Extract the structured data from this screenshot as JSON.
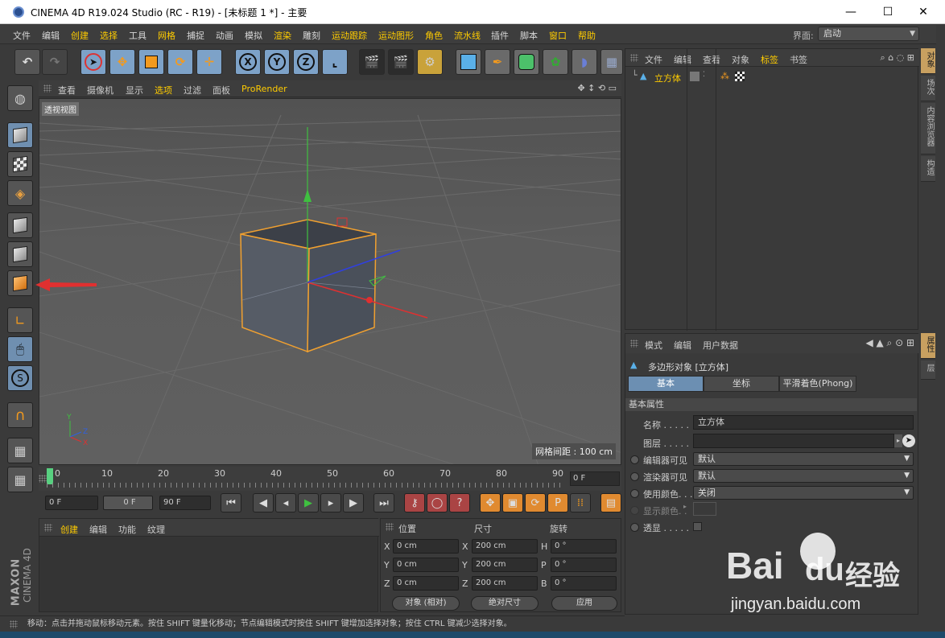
{
  "window": {
    "title": "CINEMA 4D R19.024 Studio (RC - R19) - [未标题 1 *] - 主要",
    "minimize": "—",
    "maximize": "☐",
    "close": "✕"
  },
  "menu": [
    "文件",
    "编辑",
    "创建",
    "选择",
    "工具",
    "网格",
    "捕捉",
    "动画",
    "模拟",
    "渲染",
    "雕刻",
    "运动跟踪",
    "运动图形",
    "角色",
    "流水线",
    "插件",
    "脚本",
    "窗口",
    "帮助"
  ],
  "layout": {
    "label": "界面:",
    "value": "启动"
  },
  "viewport_menu": [
    "查看",
    "摄像机",
    "显示",
    "选项",
    "过滤",
    "面板",
    "ProRender"
  ],
  "viewport": {
    "label": "透视视图",
    "grid_spacing": "网格间距 : 100 cm",
    "axis_x": "X",
    "axis_y": "Y",
    "axis_z": "Z"
  },
  "timeline": {
    "ticks": [
      "0",
      "10",
      "20",
      "30",
      "40",
      "50",
      "60",
      "70",
      "80",
      "90"
    ],
    "current_frame": "0 F"
  },
  "playback": {
    "start": "0 F",
    "preview_start": "0 F",
    "end": "90 F"
  },
  "material_menu": [
    "创建",
    "编辑",
    "功能",
    "纹理"
  ],
  "coords": {
    "headers": [
      "位置",
      "尺寸",
      "旋转"
    ],
    "rows": [
      {
        "axis": "X",
        "pos": "0 cm",
        "size_axis": "X",
        "size": "200 cm",
        "rot_axis": "H",
        "rot": "0 °"
      },
      {
        "axis": "Y",
        "pos": "0 cm",
        "size_axis": "Y",
        "size": "200 cm",
        "rot_axis": "P",
        "rot": "0 °"
      },
      {
        "axis": "Z",
        "pos": "0 cm",
        "size_axis": "Z",
        "size": "200 cm",
        "rot_axis": "B",
        "rot": "0 °"
      }
    ],
    "mode": "对象 (相对)",
    "size_mode": "绝对尺寸",
    "apply": "应用"
  },
  "status": "移动：点击并拖动鼠标移动元素。按住 SHIFT 键量化移动；节点编辑模式时按住 SHIFT 键增加选择对象；按住 CTRL 键减少选择对象。",
  "object_menu": [
    "文件",
    "编辑",
    "查看",
    "对象",
    "标签",
    "书签"
  ],
  "objects": [
    {
      "name": "立方体"
    }
  ],
  "side_tabs_top": [
    "对象",
    "场次",
    "内容浏览器",
    "构造"
  ],
  "side_tabs_bottom": [
    "属性",
    "层"
  ],
  "attr_menu": [
    "模式",
    "编辑",
    "用户数据"
  ],
  "attr": {
    "object_title": "多边形对象 [立方体]",
    "tabs": [
      "基本",
      "坐标",
      "平滑着色(Phong)"
    ],
    "section": "基本属性",
    "name_label": "名称 . . . . .",
    "name_value": "立方体",
    "layer_label": "图层 . . . . .",
    "editor_label": "编辑器可见",
    "editor_value": "默认",
    "render_label": "渲染器可见",
    "render_value": "默认",
    "usecolor_label": "使用颜色. . .",
    "usecolor_value": "关闭",
    "displaycolor_label": "显示颜色. .",
    "xray_label": "透显 . . . . ."
  },
  "watermark": {
    "brand": "Bai",
    "brand2": "du",
    "cn": "经验",
    "url": "jingyan.baidu.com"
  },
  "branding": {
    "maxon": "MAXON",
    "product": "CINEMA 4D"
  },
  "colors": {
    "accent": "#ffcc00",
    "selection": "#6c8fb2",
    "cube_outline": "#f0a030"
  }
}
